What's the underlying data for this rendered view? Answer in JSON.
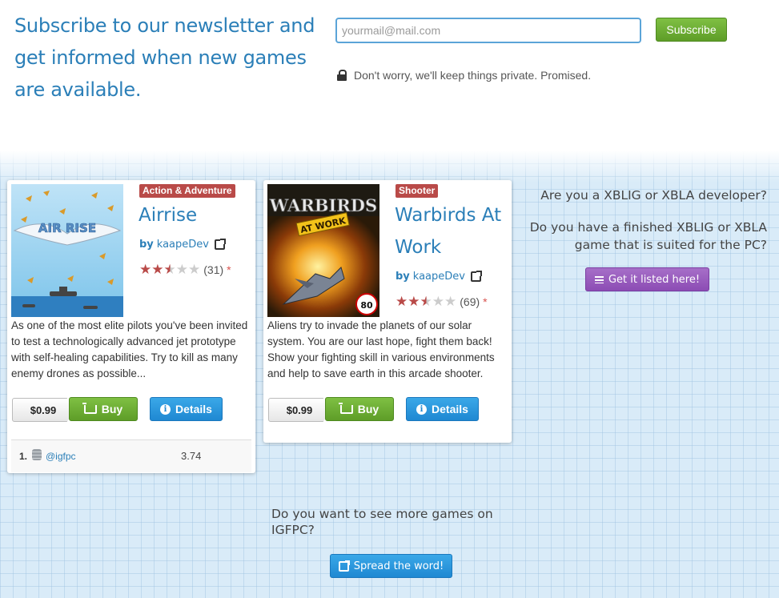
{
  "newsletter": {
    "heading": "Subscribe to our newsletter and get informed when new games are available.",
    "email_placeholder": "yourmail@mail.com",
    "email_value": "",
    "subscribe_label": "Subscribe",
    "privacy_text": "Don't worry, we'll keep things private. Promised.",
    "privacy_icon": "lock-icon"
  },
  "games": [
    {
      "genre": "Action & Adventure",
      "title": "Airrise",
      "by_label": "by",
      "author": "kaapeDev",
      "rating": 2.5,
      "rating_max": 5,
      "rating_count": "(31)",
      "rating_asterisk": "*",
      "thumb_text": "AIR RISE",
      "description": "As one of the most elite pilots you've been invited to test a technologically advanced jet prototype with self-healing capabilities. Try to kill as many enemy drones as possible...",
      "price": "$0.99",
      "buy_label": "Buy",
      "details_label": "Details",
      "leaderboard": [
        {
          "rank": "1.",
          "user": "@igfpc",
          "score": "3.74"
        }
      ]
    },
    {
      "genre": "Shooter",
      "title": "Warbirds At Work",
      "by_label": "by",
      "author": "kaapeDev",
      "rating": 2.5,
      "rating_max": 5,
      "rating_count": "(69)",
      "rating_asterisk": "*",
      "thumb_text": "WARBIRDS",
      "thumb_subtext": "AT WORK",
      "thumb_badge": "80",
      "description": "Aliens try to invade the planets of our solar system. You are our last hope, fight them back! Show your fighting skill in various environments and help to save earth in this arcade shooter.",
      "price": "$0.99",
      "buy_label": "Buy",
      "details_label": "Details"
    }
  ],
  "developer": {
    "question1": "Are you a XBLIG or XBLA developer?",
    "question2": "Do you have a finished XBLIG or XBLA game that is suited for the PC?",
    "cta_label": "Get it listed here!"
  },
  "more": {
    "question": "Do you want to see more games on IGFPC?",
    "cta_label": "Spread the word!"
  },
  "colors": {
    "heading_blue": "#2b7fb8",
    "badge_red": "#b94a48",
    "buy_green": "#6aad33",
    "details_blue": "#2a96dc",
    "listed_purple": "#9a5cbe"
  }
}
